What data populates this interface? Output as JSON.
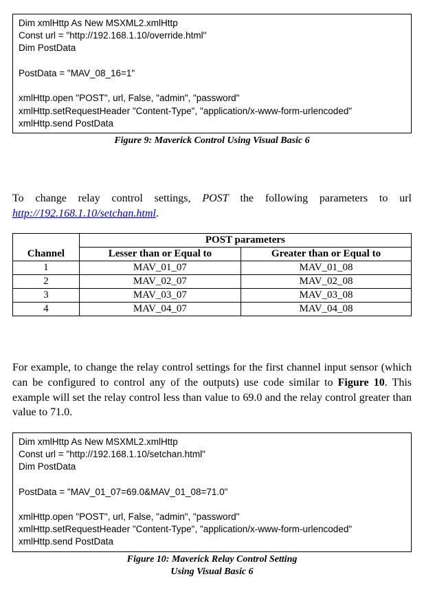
{
  "code1": {
    "line1": "Dim xmlHttp As New MSXML2.xmlHttp",
    "line2": "Const url = \"http://192.168.1.10/override.html\"",
    "line3": "Dim PostData",
    "line4": "",
    "line5": "PostData = \"MAV_08_16=1\"",
    "line6": "",
    "line7": "xmlHttp.open \"POST\", url, False, \"admin\", \"password\"",
    "line8": "xmlHttp.setRequestHeader \"Content-Type\", \"application/x-www-form-urlencoded\"",
    "line9": "xmlHttp.send PostData"
  },
  "fig9_caption": "Figure 9: Maverick Control Using Visual Basic 6",
  "para1_pre": "To change relay control settings, ",
  "para1_method": "POST",
  "para1_mid": " the following parameters to url ",
  "para1_url": "http://192.168.1.10/setchan.html",
  "para1_post": ".",
  "table": {
    "hdr_channel": "Channel",
    "hdr_post": "POST parameters",
    "hdr_lte": "Lesser than or Equal to",
    "hdr_gte": "Greater than or Equal to",
    "rows": [
      {
        "ch": "1",
        "lte": "MAV_01_07",
        "gte": "MAV_01_08"
      },
      {
        "ch": "2",
        "lte": "MAV_02_07",
        "gte": "MAV_02_08"
      },
      {
        "ch": "3",
        "lte": "MAV_03_07",
        "gte": "MAV_03_08"
      },
      {
        "ch": "4",
        "lte": "MAV_04_07",
        "gte": "MAV_04_08"
      }
    ]
  },
  "para2_pre": "For example, to change the relay control settings for the first channel input sensor (which can be configured to control any of the outputs) use code similar to ",
  "para2_figref": "Figure 10",
  "para2_post": ".  This example will set the relay control less than value to 69.0 and the relay control greater than value to 71.0.",
  "code2": {
    "line1": "Dim xmlHttp As New MSXML2.xmlHttp",
    "line2": "Const url = \"http://192.168.1.10/setchan.html\"",
    "line3": "Dim PostData",
    "line4": "",
    "line5": "PostData = \"MAV_01_07=69.0&MAV_01_08=71.0\"",
    "line6": "",
    "line7": "xmlHttp.open \"POST\", url, False, \"admin\", \"password\"",
    "line8": "xmlHttp.setRequestHeader \"Content-Type\", \"application/x-www-form-urlencoded\"",
    "line9": "xmlHttp.send PostData"
  },
  "fig10_caption_l1": "Figure 10: Maverick Relay Control Setting",
  "fig10_caption_l2": "Using Visual Basic 6"
}
